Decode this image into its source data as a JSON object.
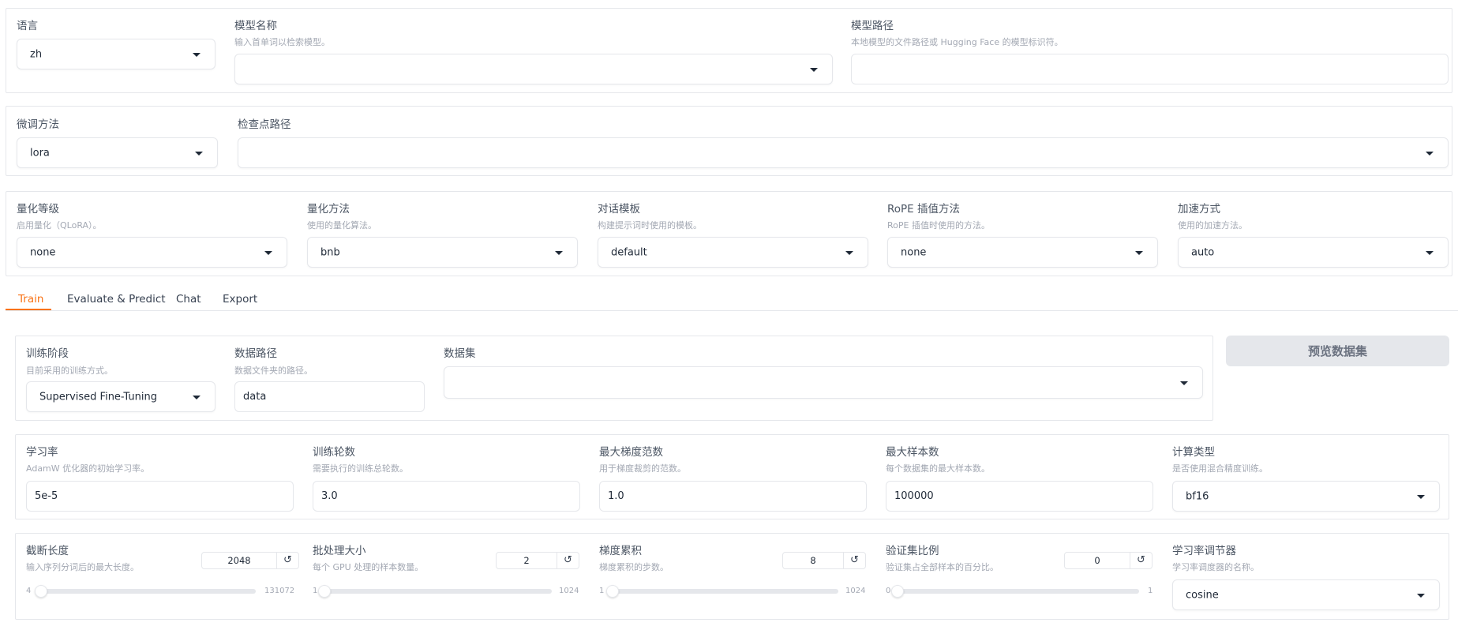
{
  "top": {
    "language": {
      "label": "语言",
      "value": "zh"
    },
    "model_name": {
      "label": "模型名称",
      "info": "输入首单词以检索模型。",
      "value": ""
    },
    "model_path": {
      "label": "模型路径",
      "info": "本地模型的文件路径或 Hugging Face 的模型标识符。",
      "value": ""
    }
  },
  "finetune": {
    "method": {
      "label": "微调方法",
      "value": "lora"
    },
    "checkpoint": {
      "label": "检查点路径",
      "value": ""
    }
  },
  "advanced": {
    "quant_bit": {
      "label": "量化等级",
      "info": "启用量化（QLoRA）。",
      "value": "none"
    },
    "quant_method": {
      "label": "量化方法",
      "info": "使用的量化算法。",
      "value": "bnb"
    },
    "template": {
      "label": "对话模板",
      "info": "构建提示词时使用的模板。",
      "value": "default"
    },
    "rope": {
      "label": "RoPE 插值方法",
      "info": "RoPE 插值时使用的方法。",
      "value": "none"
    },
    "booster": {
      "label": "加速方式",
      "info": "使用的加速方法。",
      "value": "auto"
    }
  },
  "tabs": [
    {
      "label": "Train",
      "active": true
    },
    {
      "label": "Evaluate & Predict",
      "active": false
    },
    {
      "label": "Chat",
      "active": false
    },
    {
      "label": "Export",
      "active": false
    }
  ],
  "train": {
    "stage": {
      "label": "训练阶段",
      "info": "目前采用的训练方式。",
      "value": "Supervised Fine-Tuning"
    },
    "dataset_dir": {
      "label": "数据路径",
      "info": "数据文件夹的路径。",
      "value": "data"
    },
    "dataset": {
      "label": "数据集",
      "value": ""
    },
    "preview_button": "预览数据集",
    "learning_rate": {
      "label": "学习率",
      "info": "AdamW 优化器的初始学习率。",
      "value": "5e-5"
    },
    "epochs": {
      "label": "训练轮数",
      "info": "需要执行的训练总轮数。",
      "value": "3.0"
    },
    "max_grad_norm": {
      "label": "最大梯度范数",
      "info": "用于梯度裁剪的范数。",
      "value": "1.0"
    },
    "max_samples": {
      "label": "最大样本数",
      "info": "每个数据集的最大样本数。",
      "value": "100000"
    },
    "compute_type": {
      "label": "计算类型",
      "info": "是否使用混合精度训练。",
      "value": "bf16"
    },
    "cutoff_len": {
      "label": "截断长度",
      "info": "输入序列分词后的最大长度。",
      "value": "2048",
      "min": "4",
      "max": "131072",
      "fraction": 0.0156
    },
    "batch_size": {
      "label": "批处理大小",
      "info": "每个 GPU 处理的样本数量。",
      "value": "2",
      "min": "1",
      "max": "1024",
      "fraction": 0.001
    },
    "grad_accum": {
      "label": "梯度累积",
      "info": "梯度累积的步数。",
      "value": "8",
      "min": "1",
      "max": "1024",
      "fraction": 0.0068
    },
    "val_size": {
      "label": "验证集比例",
      "info": "验证集占全部样本的百分比。",
      "value": "0",
      "min": "0",
      "max": "1",
      "fraction": 0.0
    },
    "lr_scheduler": {
      "label": "学习率调节器",
      "info": "学习率调度器的名称。",
      "value": "cosine"
    }
  },
  "colors": {
    "accent": "#f97316",
    "border": "#e5e7eb",
    "button_bg": "#e5e7eb"
  },
  "icons": {
    "dropdown": "chevron-down-icon",
    "reset": "reset-icon"
  }
}
